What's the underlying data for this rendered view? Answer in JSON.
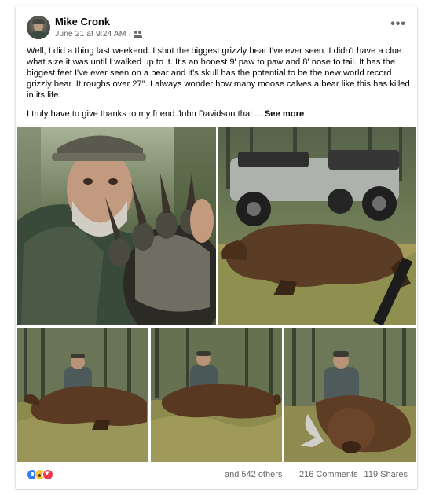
{
  "post": {
    "author": "Mike Cronk",
    "timestamp": "June 21 at 9:24 AM",
    "separator": "·",
    "privacy_icon": "friends-icon",
    "more_icon": "more-options-icon",
    "more_glyph": "•••",
    "text_paragraph_1": "Well, I did a thing last weekend. I shot the biggest grizzly bear I've ever seen. I didn't have a clue what size it was until I walked up to it. It's an honest 9' paw to paw and 8' nose to tail. It has the biggest feet I've ever seen on a bear and it's skull has the potential to be the new world record grizzly bear. It roughs over 27\".  I always wonder how many moose calves a bear like this has killed in its life.",
    "text_paragraph_2": "I truly have to give thanks to my friend John Davidson that ...",
    "see_more_label": "See more",
    "photos": [
      {
        "subject": "selfie-with-bear-paw"
      },
      {
        "subject": "bear-with-atv"
      },
      {
        "subject": "hunter-with-bear-left"
      },
      {
        "subject": "hunter-with-bear-center"
      },
      {
        "subject": "hunter-with-bear-head"
      }
    ]
  },
  "footer": {
    "reactions": [
      "like-icon",
      "wow-icon",
      "love-icon"
    ],
    "reactions_text": "and 542 others",
    "comments_label": "216 Comments",
    "shares_label": "119 Shares"
  },
  "colors": {
    "text_primary": "#050505",
    "text_secondary": "#65676b",
    "like_blue": "#2e7cf6",
    "love_red": "#f0384e",
    "wow_yellow": "#f7c33b"
  }
}
